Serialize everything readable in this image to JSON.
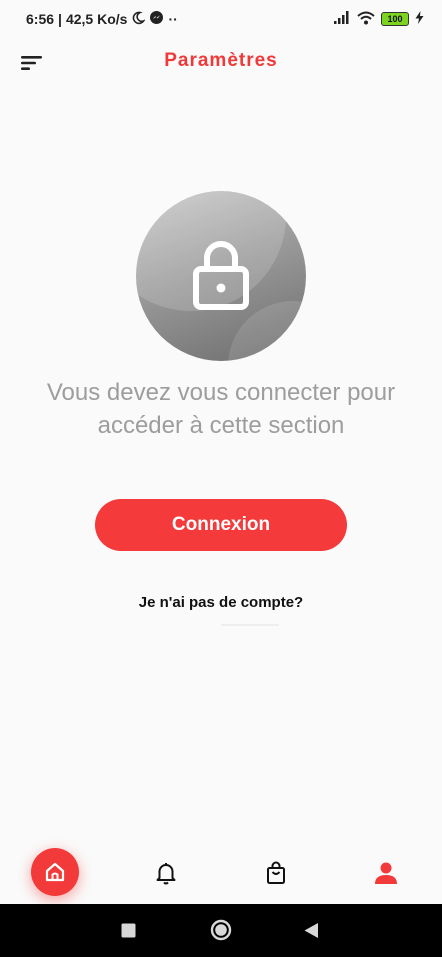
{
  "status_bar": {
    "time": "6:56",
    "speed": "42,5 Ko/s",
    "dots": "··",
    "battery": "100"
  },
  "header": {
    "title": "Paramètres"
  },
  "main": {
    "message_line1": "Vous devez vous connecter pour",
    "message_line2": "accéder à cette section",
    "login_button": "Connexion",
    "no_account_link": "Je n'ai pas de compte?"
  },
  "bottom_nav": {
    "items": [
      "home-icon",
      "bell-icon",
      "shopping-bag-icon",
      "user-icon"
    ],
    "active_color": "#f33a3a"
  },
  "colors": {
    "accent": "#f43a3a",
    "message_text": "#9d9d9d"
  }
}
